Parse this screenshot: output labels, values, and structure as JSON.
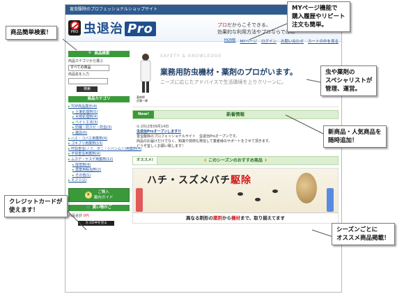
{
  "site": {
    "topbar": "害虫駆除のプロフェッショナルショップサイト",
    "logo_text": "虫退治",
    "logo_pro": "Pro",
    "logo_badge": "PRO",
    "tagline_line1_prefix": "プロ",
    "tagline_line1_rest": "だからこそできる、",
    "tagline_line2": "効果的な利用方法やプロならではの"
  },
  "nav": [
    "HOME",
    "MYページ",
    "ログイン",
    "お問い合わせ",
    "カートの中を見る"
  ],
  "sidebar": {
    "search_head": "商品検索",
    "category_label": "商品カテゴリから選ぶ",
    "category_value": "すべての商品",
    "name_label": "商品名を入力",
    "search_button": "検索",
    "category_head": "商品カテゴリ",
    "categories": [
      {
        "label": "TOP商品展示(4)",
        "sub": false
      },
      {
        "label": "土壌処理剤(5)",
        "sub": true
      },
      {
        "label": "木部処理剤(4)",
        "sub": true
      },
      {
        "label": "ベイト工法(3)",
        "sub": true
      },
      {
        "label": "防蟻・防カビ・防虫(3)",
        "sub": true
      },
      {
        "label": "器具(6)",
        "sub": true
      },
      {
        "label": "ハエ・コバエ用薬剤(4)",
        "sub": false
      },
      {
        "label": "ゴキブリ用薬剤(13)",
        "sub": false
      },
      {
        "label": "貯穀害虫(ノミ、ダニ・シバンムシ)用薬剤(4)",
        "sub": false
      },
      {
        "label": "不快害虫用薬剤(4)",
        "sub": false
      },
      {
        "label": "ムカデ・ヤスデ用薬剤(12)",
        "sub": false
      },
      {
        "label": "除草剤(4)",
        "sub": true
      },
      {
        "label": "農薬用殺虫剤(2)",
        "sub": true
      },
      {
        "label": "その他(1)",
        "sub": true
      },
      {
        "label": "ネズミ(2)",
        "sub": false
      }
    ],
    "guide_button": "ご購入\n案内ガイド",
    "guide_icon": "¥",
    "cart_head": "買い物かご",
    "cart_amount_label": "商品合計",
    "cart_amount_value": "0円",
    "cart_button": "カゴの中を見る"
  },
  "hero": {
    "knowledge": "SAFETY & KNOWLEDGE",
    "title": "業務用防虫機材・薬剤のプロがいます。",
    "subtitle": "ニーズに応じたアドバイスで生活環境を上りクリーンに。",
    "person_caption": "薬剤師\n武藤一輝"
  },
  "news": {
    "tag": "New!",
    "title": "新着情報",
    "rss": "RSS",
    "date": "2012年09月14日",
    "headline": "虫退治Proオープンします!!",
    "body_line1": "害虫駆除のプロフェッショナルサイト　虫退治Proオープンです。",
    "body_line2": "商品のお届けだけでなく、知識や技術も発信して業者様のサポートをさせて頂きます。",
    "body_line3": "どうぞ宜しくお願い致します！"
  },
  "recommend": {
    "tag": "オススメ!",
    "title": "このシーズンのおすすめ商品"
  },
  "banner": {
    "main_prefix": "ハチ・スズメバチ",
    "main_red": "駆除",
    "strip_1": "異なる剤形の",
    "strip_r1": "薬剤",
    "strip_2": "から",
    "strip_r2": "機材",
    "strip_3": "まで、取り揃えてます"
  },
  "callouts": {
    "search": "商品簡単検索！",
    "mypage": "MYページ機能で\n購入履歴やリピート\n注文も簡単。",
    "specialist": "虫や薬剤の\nスペシャリストが\n管理、運営。",
    "news": "新商品・人気商品を\n随時追加！",
    "credit": "クレジットカードが\n使えます！",
    "season": "シーズンごとに\nオススメ商品掲載！"
  },
  "colors": {
    "brand_blue": "#1f4e8c",
    "green": "#3a9a3a",
    "red": "#d21b1b"
  }
}
